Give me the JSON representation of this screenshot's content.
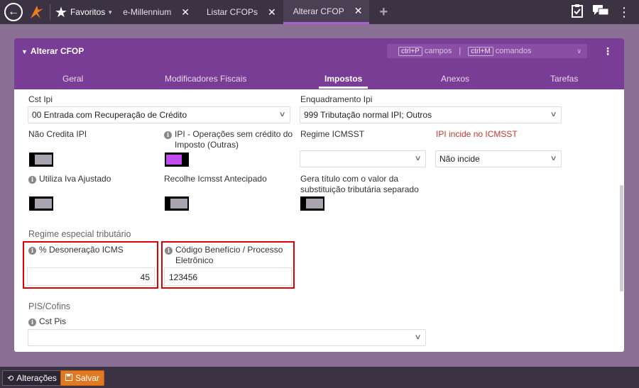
{
  "topbar": {
    "favorites_label": "Favoritos",
    "tabs": [
      {
        "label": "e-Millennium"
      },
      {
        "label": "Listar CFOPs"
      },
      {
        "label": "Alterar CFOP"
      }
    ]
  },
  "panel": {
    "title": "Alterar CFOP",
    "search": {
      "key1": "ctrl+P",
      "label1": "campos",
      "key2": "ctrl+M",
      "label2": "comandos"
    },
    "tabs": [
      "Geral",
      "Modificadores Fiscais",
      "Impostos",
      "Anexos",
      "Tarefas"
    ],
    "active_tab": "Impostos"
  },
  "form": {
    "cst_ipi": {
      "label": "Cst Ipi",
      "value": "00 Entrada com Recuperação de Crédito"
    },
    "enquadramento_ipi": {
      "label": "Enquadramento Ipi",
      "value": "999 Tributação normal IPI; Outros"
    },
    "nao_credita_ipi": {
      "label": "Não Credita IPI"
    },
    "ipi_operacoes": {
      "label_line1": "IPI - Operações sem crédito do",
      "label_line2": "Imposto (Outras)"
    },
    "regime_icmsst": {
      "label": "Regime ICMSST",
      "value": ""
    },
    "ipi_incide": {
      "label": "IPI incide no ICMSST",
      "value": "Não incide"
    },
    "utiliza_iva": {
      "label": "Utiliza Iva Ajustado"
    },
    "recolhe_icmsst": {
      "label": "Recolhe Icmsst Antecipado"
    },
    "gera_titulo": {
      "label_line1": "Gera título com o valor da",
      "label_line2": "substituição tributária separado"
    },
    "regime_especial": {
      "section": "Regime especial tributário",
      "desoneracao": {
        "label": "% Desoneração ICMS",
        "value": "45"
      },
      "codigo_beneficio": {
        "label_line1": "Código Benefício / Processo",
        "label_line2": "Eletrônico",
        "value": "123456"
      }
    },
    "pis_cofins": {
      "section": "PIS/Cofins",
      "cst_pis": {
        "label": "Cst Pis",
        "value": ""
      }
    }
  },
  "bottom": {
    "alteracoes_label": "Alterações",
    "salvar_label": "Salvar"
  },
  "colors": {
    "accent": "#7a3d96",
    "toggle_on": "#c34cf0",
    "highlight": "#e00000",
    "save": "#e07a22"
  }
}
